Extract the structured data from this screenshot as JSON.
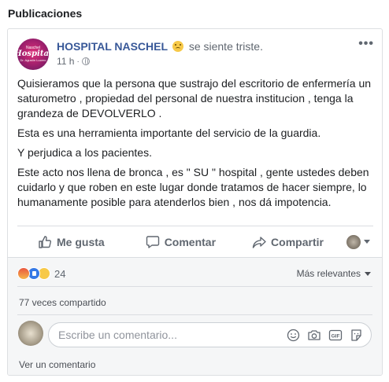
{
  "section": {
    "title": "Publicaciones"
  },
  "post": {
    "author": "HOSPITAL NASCHEL",
    "feeling": "se siente triste.",
    "time": "11 h",
    "avatar_text": [
      "Naschel",
      "Hospital",
      "Dr. Agustín Lucero"
    ],
    "paragraphs": [
      "Quisieramos que la persona que sustrajo del escritorio de enfermería un saturometro , propiedad del personal de nuestra institucion , tenga la grandeza de DEVOLVERLO .",
      "Esta es una herramienta importante del servicio de la guardia.",
      "Y perjudica a los pacientes.",
      "Este acto nos llena de bronca , es \" SU \" hospital , gente ustedes deben cuidarlo y que roben en este lugar donde tratamos de hacer siempre, lo humanamente posible para atenderlos bien , nos dá impotencia."
    ]
  },
  "actions": {
    "like": "Me gusta",
    "comment": "Comentar",
    "share": "Compartir"
  },
  "footer": {
    "reaction_count": "24",
    "sort_label": "Más relevantes",
    "shares": "77 veces compartido",
    "comment_placeholder": "Escribe un comentario...",
    "view_comment": "Ver un comentario"
  },
  "colors": {
    "author_link": "#385898",
    "accent_like": "#3578e5",
    "footer_bg": "#f5f6f7"
  },
  "icons": [
    "more-icon",
    "globe-icon",
    "like-icon",
    "comment-icon",
    "share-icon",
    "caret-down-icon",
    "emoji-icon",
    "camera-icon",
    "gif-icon",
    "sticker-icon"
  ]
}
